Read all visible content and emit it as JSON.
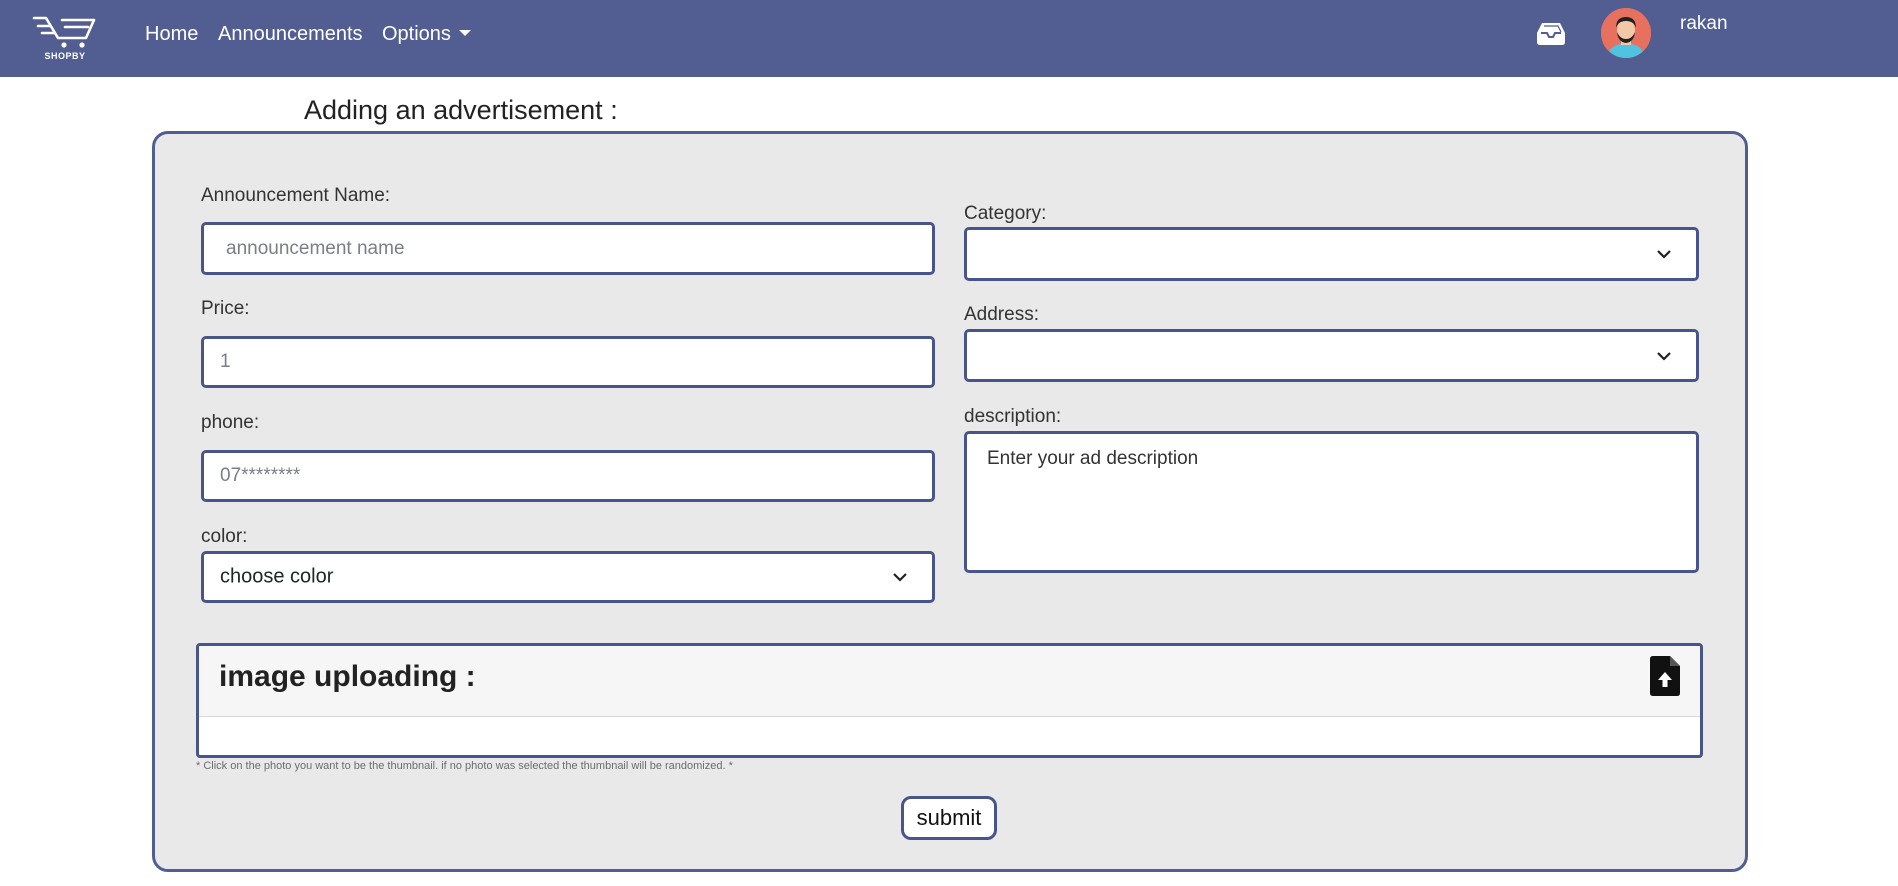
{
  "brand": {
    "name": "SHOPBY"
  },
  "nav": {
    "home": "Home",
    "announcements": "Announcements",
    "options": "Options"
  },
  "user": {
    "name": "rakan"
  },
  "page": {
    "title": "Adding an advertisement :"
  },
  "form": {
    "name_label": "Announcement Name:",
    "name_placeholder": "announcement name",
    "price_label": "Price:",
    "price_placeholder": "1",
    "phone_label": "phone:",
    "phone_placeholder": "07********",
    "color_label": "color:",
    "color_selected": "choose color",
    "category_label": "Category:",
    "category_selected": "",
    "address_label": "Address:",
    "address_selected": "",
    "description_label": "description:",
    "description_placeholder": "Enter your ad description"
  },
  "upload": {
    "title": "image uploading :",
    "note": "* Click on the photo you want to be the thumbnail. if no photo was selected the thumbnail will be randomized. *"
  },
  "submit_label": "submit",
  "icons": {
    "logo": "cart-logo-icon",
    "inbox": "inbox-icon",
    "upload": "file-upload-icon",
    "dropdown": "chevron-down-icon"
  },
  "colors": {
    "navbar": "#525e92",
    "border": "#48548a",
    "card_bg": "#e9e9ea"
  }
}
